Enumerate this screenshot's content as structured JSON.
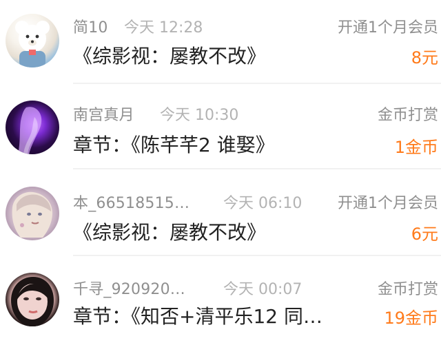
{
  "colors": {
    "name": "#8f8f8f",
    "time": "#b3b3b3",
    "title": "#222222",
    "amount": "#ff7a1a",
    "divider": "#f1f1f1"
  },
  "items": [
    {
      "avatar_icon": "teddy-bear-avatar",
      "name": "简10",
      "time": "今天 12:28",
      "action": "开通1个月会员",
      "title": "《综影视：屡教不改》",
      "amount": "8元"
    },
    {
      "avatar_icon": "purple-portrait-avatar",
      "name": "南宫真月",
      "time": "今天 10:30",
      "action": "金币打赏",
      "title": "章节：《陈芊芊2  谁娶》",
      "amount": "1金币"
    },
    {
      "avatar_icon": "anime-girl-avatar",
      "name": "本_66518515…",
      "time": "今天 06:10",
      "action": "开通1个月会员",
      "title": "《综影视：屡教不改》",
      "amount": "6元"
    },
    {
      "avatar_icon": "photo-portrait-avatar",
      "name": "千寻_920920…",
      "time": "今天 00:07",
      "action": "金币打赏",
      "title": "章节：《知否+清平乐12  同…",
      "amount": "19金币"
    }
  ]
}
